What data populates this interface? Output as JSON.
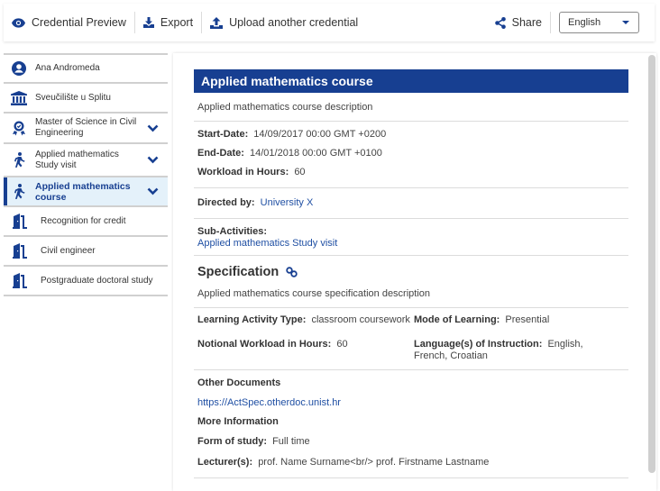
{
  "toolbar": {
    "preview_label": "Credential Preview",
    "export_label": "Export",
    "upload_label": "Upload another credential",
    "share_label": "Share",
    "language_selected": "English"
  },
  "icons": {
    "preview": "eye-icon",
    "export": "download-icon",
    "upload": "upload-icon",
    "share": "share-icon",
    "language": "chevron-down-icon"
  },
  "colors": {
    "brand": "#173f91",
    "active_bg": "#e4f1fa",
    "link": "#1f4fa3"
  },
  "sidebar": {
    "items": [
      {
        "label": "Ana Andromeda",
        "icon": "user-icon",
        "expandable": false
      },
      {
        "label": "Sveučilište u Splitu",
        "icon": "institution-icon",
        "expandable": false
      },
      {
        "label": "Master of Science in Civil Engineering",
        "icon": "award-icon",
        "expandable": true
      },
      {
        "label": "Applied mathematics Study visit",
        "icon": "walking-icon",
        "expandable": true
      },
      {
        "label": "Applied mathematics course",
        "icon": "walking-icon",
        "expandable": true,
        "active": true
      },
      {
        "label": "Recognition for credit",
        "icon": "door-icon",
        "expandable": false
      },
      {
        "label": "Civil engineer",
        "icon": "door-icon",
        "expandable": false
      },
      {
        "label": "Postgraduate doctoral study",
        "icon": "door-icon",
        "expandable": false
      }
    ]
  },
  "main": {
    "title": "Applied mathematics course",
    "description": "Applied mathematics course description",
    "dates": {
      "start_label": "Start-Date:",
      "start_value": "14/09/2017 00:00 GMT +0200",
      "end_label": "End-Date:",
      "end_value": "14/01/2018 00:00 GMT +0100",
      "workload_label": "Workload in Hours:",
      "workload_value": "60"
    },
    "directed_by_label": "Directed by:",
    "directed_by_value": "University X",
    "sub_activities_label": "Sub-Activities:",
    "sub_activities_value": "Applied mathematics Study visit",
    "specification": {
      "heading": "Specification",
      "description": "Applied mathematics course specification description",
      "learning_activity_type_label": "Learning Activity Type:",
      "learning_activity_type_value": "classroom coursework",
      "mode_of_learning_label": "Mode of Learning:",
      "mode_of_learning_value": "Presential",
      "notional_workload_label": "Notional Workload in Hours:",
      "notional_workload_value": "60",
      "languages_label": "Language(s) of Instruction:",
      "languages_value": "English, French, Croatian"
    },
    "other_documents_heading": "Other Documents",
    "other_documents_link": "https://ActSpec.otherdoc.unist.hr",
    "more_info_heading": "More Information",
    "form_of_study_label": "Form of study:",
    "form_of_study_value": "Full time",
    "lecturers_label": "Lecturer(s):",
    "lecturers_value": "prof. Name Surname<br/> prof. Firstname Lastname"
  }
}
